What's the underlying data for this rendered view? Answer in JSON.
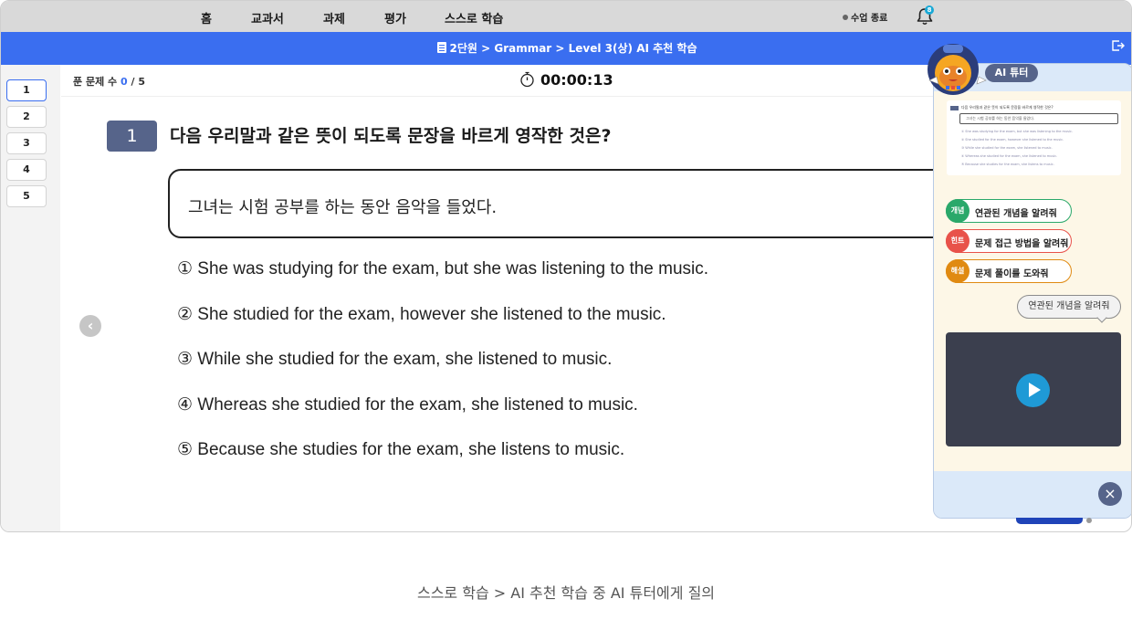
{
  "nav": {
    "items": [
      "홈",
      "교과서",
      "과제",
      "평가",
      "스스로 학습"
    ],
    "end_class": "수업 종료",
    "bell_badge": "8"
  },
  "header": {
    "breadcrumb": "2단원 > Grammar > Level 3(상) AI 추천 학습"
  },
  "sidebar": {
    "questions": [
      "1",
      "2",
      "3",
      "4",
      "5"
    ],
    "active": "1"
  },
  "status": {
    "solved_label": "푼 문제 수",
    "solved_current": "0",
    "solved_total": "/ 5",
    "timer": "00:00:13"
  },
  "question": {
    "number": "1",
    "text": "다음 우리말과 같은 뜻이 되도록 문장을 바르게 영작한 것은?",
    "given": "그녀는 시험 공부를 하는 동안 음악을 들었다.",
    "choices": [
      "① She was studying for the exam, but she was listening to the music.",
      "② She studied for the exam, however she listened to the music.",
      "③ While she studied for the exam, she listened to music.",
      "④ Whereas she studied for the exam, she listened to music.",
      "⑤ Because she studies for the exam, she listens to music."
    ]
  },
  "tutor": {
    "title": "AI 튜터",
    "mini_title": "다음 우리말과 같은 뜻이 되도록 문장을 바르게 영작한 것은?",
    "mini_given": "그녀는 시험 공부를 하는 동안 음악을 들었다.",
    "mini_choices": [
      "① She was studying for the exam, but she was listening to the music.",
      "② She studied for the exam, however she listened to the music.",
      "③ While she studied for the exam, she listened to music.",
      "④ Whereas she studied for the exam, she listened to music.",
      "⑤ Because she studies for the exam, she listens to music."
    ],
    "chips": [
      {
        "tag": "개념",
        "label": "연관된 개념을 알려줘",
        "color": "#2aa86a"
      },
      {
        "tag": "힌트",
        "label": "문제 접근 방법을 알려줘",
        "color": "#e8524a"
      },
      {
        "tag": "해설",
        "label": "문제 풀이를 도와줘",
        "color": "#e08a12"
      }
    ],
    "bubble": "연관된 개념을 알려줘",
    "close": "×"
  },
  "prev_arrow": "‹",
  "caption": "스스로 학습 > AI 추천 학습 중 AI 튜터에게 질의"
}
